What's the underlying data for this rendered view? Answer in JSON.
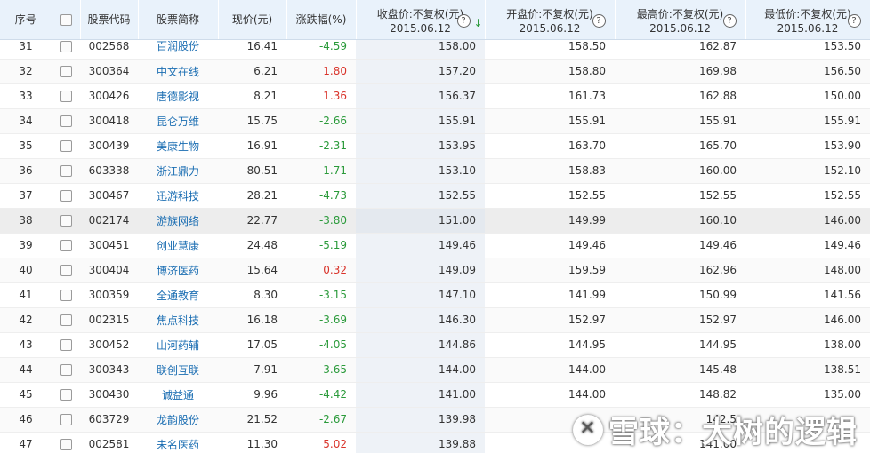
{
  "header": {
    "idx": "序号",
    "code": "股票代码",
    "name": "股票简称",
    "price": "现价(元)",
    "change": "涨跌幅(%)",
    "close": {
      "label": "收盘价:不复权(元)",
      "date": "2015.06.12",
      "help": "?",
      "sort": "↓"
    },
    "open": {
      "label": "开盘价:不复权(元)",
      "date": "2015.06.12",
      "help": "?"
    },
    "high": {
      "label": "最高价:不复权(元)",
      "date": "2015.06.12",
      "help": "?"
    },
    "low": {
      "label": "最低价:不复权(元)",
      "date": "2015.06.12",
      "help": "?"
    }
  },
  "rows": [
    {
      "idx": "31",
      "code": "002568",
      "name": "百润股份",
      "price": "16.41",
      "change": "-4.59",
      "dir": "down",
      "close": "158.00",
      "open": "158.50",
      "high": "162.87",
      "low": "153.50"
    },
    {
      "idx": "32",
      "code": "300364",
      "name": "中文在线",
      "price": "6.21",
      "change": "1.80",
      "dir": "up",
      "close": "157.20",
      "open": "158.80",
      "high": "169.98",
      "low": "156.50"
    },
    {
      "idx": "33",
      "code": "300426",
      "name": "唐德影视",
      "price": "8.21",
      "change": "1.36",
      "dir": "up",
      "close": "156.37",
      "open": "161.73",
      "high": "162.88",
      "low": "150.00"
    },
    {
      "idx": "34",
      "code": "300418",
      "name": "昆仑万维",
      "price": "15.75",
      "change": "-2.66",
      "dir": "down",
      "close": "155.91",
      "open": "155.91",
      "high": "155.91",
      "low": "155.91"
    },
    {
      "idx": "35",
      "code": "300439",
      "name": "美康生物",
      "price": "16.91",
      "change": "-2.31",
      "dir": "down",
      "close": "153.95",
      "open": "163.70",
      "high": "165.70",
      "low": "153.90"
    },
    {
      "idx": "36",
      "code": "603338",
      "name": "浙江鼎力",
      "price": "80.51",
      "change": "-1.71",
      "dir": "down",
      "close": "153.10",
      "open": "158.83",
      "high": "160.00",
      "low": "152.10"
    },
    {
      "idx": "37",
      "code": "300467",
      "name": "迅游科技",
      "price": "28.21",
      "change": "-4.73",
      "dir": "down",
      "close": "152.55",
      "open": "152.55",
      "high": "152.55",
      "low": "152.55"
    },
    {
      "idx": "38",
      "code": "002174",
      "name": "游族网络",
      "price": "22.77",
      "change": "-3.80",
      "dir": "down",
      "close": "151.00",
      "open": "149.99",
      "high": "160.10",
      "low": "146.00"
    },
    {
      "idx": "39",
      "code": "300451",
      "name": "创业慧康",
      "price": "24.48",
      "change": "-5.19",
      "dir": "down",
      "close": "149.46",
      "open": "149.46",
      "high": "149.46",
      "low": "149.46"
    },
    {
      "idx": "40",
      "code": "300404",
      "name": "博济医药",
      "price": "15.64",
      "change": "0.32",
      "dir": "up",
      "close": "149.09",
      "open": "159.59",
      "high": "162.96",
      "low": "148.00"
    },
    {
      "idx": "41",
      "code": "300359",
      "name": "全通教育",
      "price": "8.30",
      "change": "-3.15",
      "dir": "down",
      "close": "147.10",
      "open": "141.99",
      "high": "150.99",
      "low": "141.56"
    },
    {
      "idx": "42",
      "code": "002315",
      "name": "焦点科技",
      "price": "16.18",
      "change": "-3.69",
      "dir": "down",
      "close": "146.30",
      "open": "152.97",
      "high": "152.97",
      "low": "146.00"
    },
    {
      "idx": "43",
      "code": "300452",
      "name": "山河药辅",
      "price": "17.05",
      "change": "-4.05",
      "dir": "down",
      "close": "144.86",
      "open": "144.95",
      "high": "144.95",
      "low": "138.00"
    },
    {
      "idx": "44",
      "code": "300343",
      "name": "联创互联",
      "price": "7.91",
      "change": "-3.65",
      "dir": "down",
      "close": "144.00",
      "open": "144.00",
      "high": "145.48",
      "low": "138.51"
    },
    {
      "idx": "45",
      "code": "300430",
      "name": "诚益通",
      "price": "9.96",
      "change": "-4.42",
      "dir": "down",
      "close": "141.00",
      "open": "144.00",
      "high": "148.82",
      "low": "135.00"
    },
    {
      "idx": "46",
      "code": "603729",
      "name": "龙韵股份",
      "price": "21.52",
      "change": "-2.67",
      "dir": "down",
      "close": "139.98",
      "open": "",
      "high": "142.5",
      "low": ""
    },
    {
      "idx": "47",
      "code": "002581",
      "name": "未名医药",
      "price": "11.30",
      "change": "5.02",
      "dir": "up",
      "close": "139.88",
      "open": "",
      "high": "141.00",
      "low": ""
    }
  ],
  "highlight_row": 7,
  "watermark": "雪球：大树的逻辑"
}
